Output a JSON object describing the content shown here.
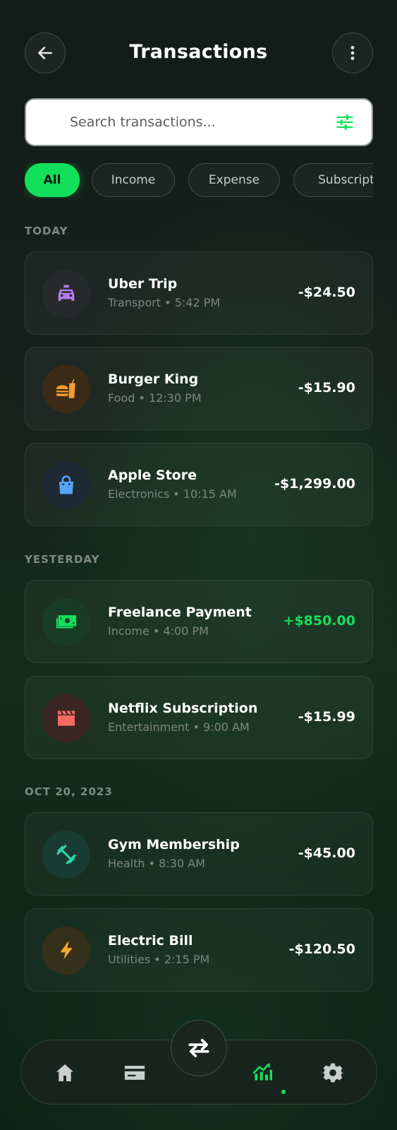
{
  "header": {
    "title": "Transactions",
    "back_icon": "arrow-left-icon",
    "more_icon": "vertical-dots-icon"
  },
  "search": {
    "placeholder": "Search transactions...",
    "value": "",
    "filter_icon": "sliders-icon"
  },
  "filters": [
    {
      "label": "All",
      "active": true
    },
    {
      "label": "Income",
      "active": false
    },
    {
      "label": "Expense",
      "active": false
    },
    {
      "label": "Subscript",
      "active": false
    }
  ],
  "sections": [
    {
      "label": "TODAY",
      "items": [
        {
          "name": "Uber Trip",
          "meta": "Transport • 5:42 PM",
          "amount": "-$24.50",
          "icon": "taxi-icon",
          "color": "#b57cf2",
          "bg": "#272a2d"
        },
        {
          "name": "Burger King",
          "meta": "Food • 12:30 PM",
          "amount": "-$15.90",
          "icon": "fast-food-icon",
          "color": "#f59b2f",
          "bg": "#3a2a16"
        },
        {
          "name": "Apple Store",
          "meta": "Electronics • 10:15 AM",
          "amount": "-$1,299.00",
          "icon": "shopping-bag-icon",
          "color": "#56a4f5",
          "bg": "#1e2a33"
        }
      ]
    },
    {
      "label": "YESTERDAY",
      "items": [
        {
          "name": "Freelance Payment",
          "meta": "Income • 4:00 PM",
          "amount": "+$850.00",
          "icon": "money-icon",
          "color": "#14e05a",
          "bg": "#183c26",
          "positive": true
        },
        {
          "name": "Netflix Subscription",
          "meta": "Entertainment • 9:00 AM",
          "amount": "-$15.99",
          "icon": "clapperboard-icon",
          "color": "#f26a62",
          "bg": "#3a2522"
        }
      ]
    },
    {
      "label": "OCT 20, 2023",
      "items": [
        {
          "name": "Gym Membership",
          "meta": "Health • 8:30 AM",
          "amount": "-$45.00",
          "icon": "dumbbell-icon",
          "color": "#2ed3a8",
          "bg": "#183b32"
        },
        {
          "name": "Electric Bill",
          "meta": "Utilities • 2:15 PM",
          "amount": "-$120.50",
          "icon": "lightning-icon",
          "color": "#f5a92b",
          "bg": "#35301a"
        }
      ]
    }
  ],
  "nav": {
    "items": [
      {
        "name": "home-icon"
      },
      {
        "name": "card-icon"
      },
      {
        "name": "transfer-icon"
      },
      {
        "name": "chart-icon",
        "active": true
      },
      {
        "name": "settings-icon"
      }
    ],
    "accent": "#14e05a"
  }
}
